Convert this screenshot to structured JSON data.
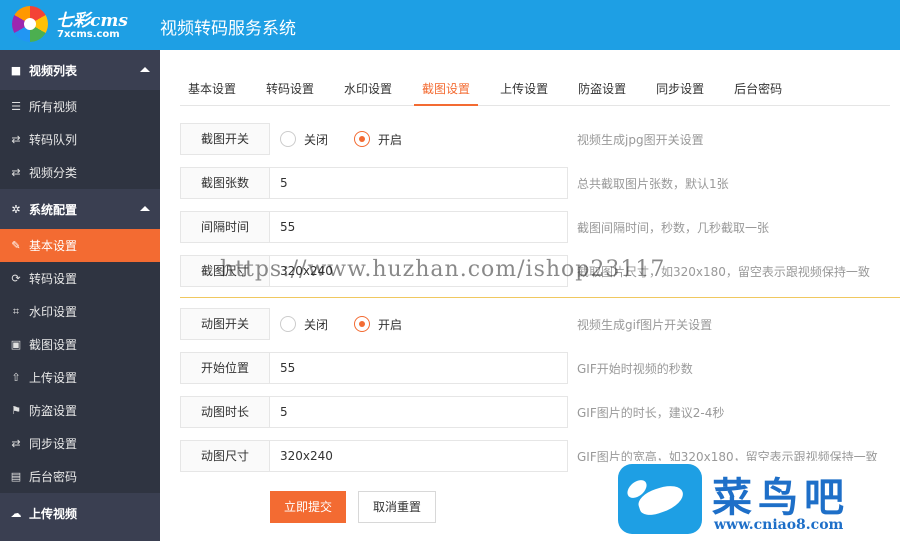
{
  "header": {
    "logo_name": "七彩cms",
    "logo_url": "7xcms.com",
    "title": "视频转码服务系统"
  },
  "sidebar": {
    "groups": [
      {
        "label": "视频列表",
        "icon": "video-camera-icon"
      },
      {
        "label": "系统配置",
        "icon": "gear-icon"
      }
    ],
    "video_items": [
      {
        "label": "所有视频",
        "icon": "list-icon"
      },
      {
        "label": "转码队列",
        "icon": "exchange-icon"
      },
      {
        "label": "视频分类",
        "icon": "exchange-icon"
      }
    ],
    "config_items": [
      {
        "label": "基本设置",
        "icon": "edit-icon"
      },
      {
        "label": "转码设置",
        "icon": "refresh-icon"
      },
      {
        "label": "水印设置",
        "icon": "crop-icon"
      },
      {
        "label": "截图设置",
        "icon": "image-icon"
      },
      {
        "label": "上传设置",
        "icon": "upload-icon"
      },
      {
        "label": "防盗设置",
        "icon": "flag-icon"
      },
      {
        "label": "同步设置",
        "icon": "exchange-icon"
      },
      {
        "label": "后台密码",
        "icon": "download-box-icon"
      }
    ],
    "upload_video": {
      "label": "上传视频",
      "icon": "cloud-upload-icon"
    },
    "active_item": "基本设置"
  },
  "tabs": [
    "基本设置",
    "转码设置",
    "水印设置",
    "截图设置",
    "上传设置",
    "防盗设置",
    "同步设置",
    "后台密码"
  ],
  "active_tab": "截图设置",
  "form": {
    "screenshot_switch": {
      "label": "截图开关",
      "off": "关闭",
      "on": "开启",
      "selected": "开启",
      "hint": "视频生成jpg图开关设置"
    },
    "screenshot_count": {
      "label": "截图张数",
      "value": "5",
      "hint": "总共截取图片张数，默认1张"
    },
    "interval": {
      "label": "间隔时间",
      "value": "55",
      "hint": "截图间隔时间，秒数，几秒截取一张"
    },
    "screenshot_size": {
      "label": "截图尺寸",
      "value": "320x240",
      "hint": "截取图片尺寸，如320x180，留空表示跟视频保持一致"
    },
    "gif_switch": {
      "label": "动图开关",
      "off": "关闭",
      "on": "开启",
      "selected": "开启",
      "hint": "视频生成gif图片开关设置"
    },
    "start_position": {
      "label": "开始位置",
      "value": "55",
      "hint": "GIF开始时视频的秒数"
    },
    "gif_duration": {
      "label": "动图时长",
      "value": "5",
      "hint": "GIF图片的时长，建议2-4秒"
    },
    "gif_size": {
      "label": "动图尺寸",
      "value": "320x240",
      "hint": "GIF图片的宽高，如320x180，留空表示跟视频保持一致"
    }
  },
  "buttons": {
    "submit": "立即提交",
    "reset": "取消重置"
  },
  "overlay": {
    "watermark": "https://www.huzhan.com/ishop23117",
    "badge_title": "菜鸟吧",
    "badge_url": "www.cniao8.com"
  },
  "colors": {
    "header": "#1e9fe4",
    "sidebar": "#3a3f51",
    "accent": "#f36b32"
  }
}
